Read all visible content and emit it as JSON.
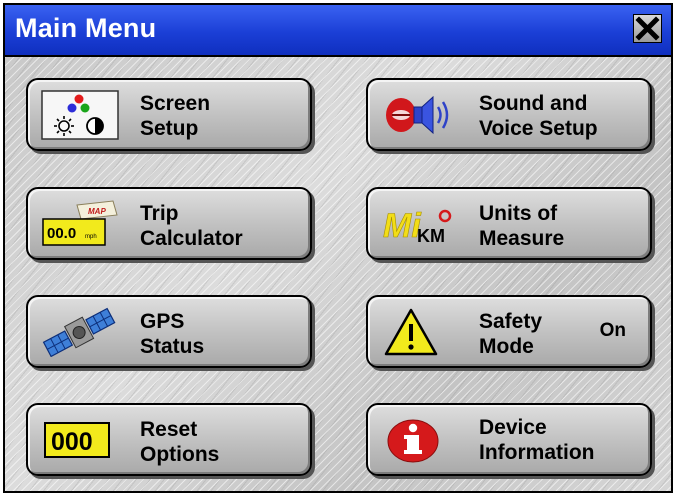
{
  "window": {
    "title": "Main Menu"
  },
  "buttons": {
    "screen_setup": {
      "line1": "Screen",
      "line2": "Setup"
    },
    "sound_voice": {
      "line1": "Sound and",
      "line2": "Voice Setup"
    },
    "trip_calculator": {
      "line1": "Trip",
      "line2": "Calculator",
      "icon_text": "00.0",
      "icon_unit": "mph",
      "icon_tag": "MAP"
    },
    "units_of_measure": {
      "line1": "Units of",
      "line2": "Measure",
      "icon_mi": "Mi",
      "icon_km": "KM"
    },
    "gps_status": {
      "line1": "GPS",
      "line2": "Status"
    },
    "safety_mode": {
      "line1": "Safety",
      "line2": "Mode",
      "state": "On"
    },
    "reset_options": {
      "line1": "Reset",
      "line2": "Options",
      "icon_text": "000"
    },
    "device_information": {
      "line1": "Device",
      "line2": "Information"
    }
  },
  "icons": {
    "screen_setup": "rgb-dots-brightness-contrast-icon",
    "sound_voice": "lips-speaker-icon",
    "trip_calculator": "odometer-icon",
    "units_of_measure": "mi-km-icon",
    "gps_status": "satellite-icon",
    "safety_mode": "warning-triangle-icon",
    "reset_options": "counter-reset-icon",
    "device_information": "info-icon",
    "close": "close-icon"
  },
  "colors": {
    "titlebar": "#1b3fd6",
    "title_text": "#ffffff",
    "counter_bg": "#f2ea1c",
    "info_red": "#d5191b"
  }
}
